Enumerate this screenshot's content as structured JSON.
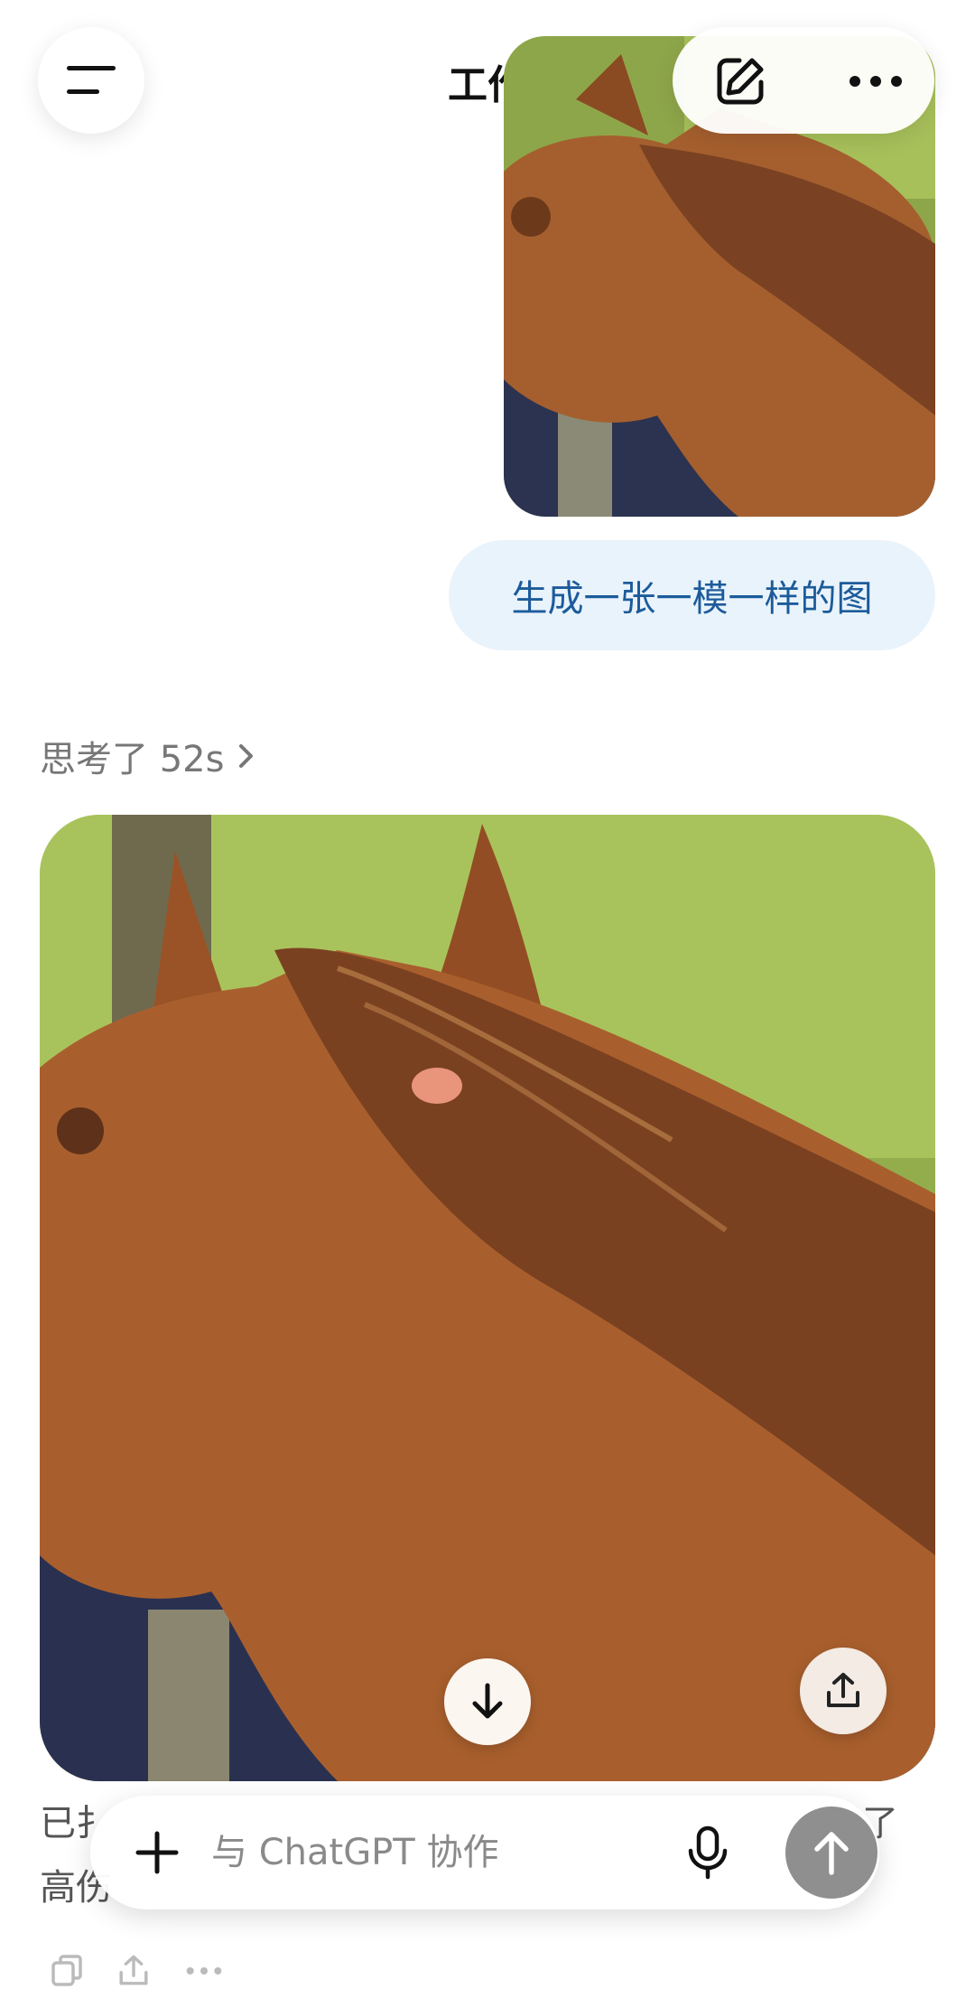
{
  "header": {
    "title": "工作",
    "icons": {
      "menu": "menu-icon",
      "edit": "edit-icon",
      "more": "more-icon"
    }
  },
  "conversation": {
    "user_message": "生成一张一模一样的图",
    "thinking_label": "思考了 52s",
    "response_fragments": {
      "line1": "已扌",
      "line1_tail": "了",
      "line2": "高伤"
    }
  },
  "composer": {
    "placeholder": "与 ChatGPT 协作",
    "icons": {
      "add": "plus-icon",
      "mic": "mic-icon",
      "send": "arrow-up-icon"
    }
  },
  "image_controls": {
    "scroll": "arrow-down-icon",
    "share": "share-icon"
  },
  "message_actions": [
    "copy-icon",
    "share-icon",
    "more-icon"
  ],
  "colors": {
    "user_bubble_bg": "#e9f3fc",
    "user_bubble_text": "#1c5b9a",
    "send_button": "#8f8f8f"
  }
}
